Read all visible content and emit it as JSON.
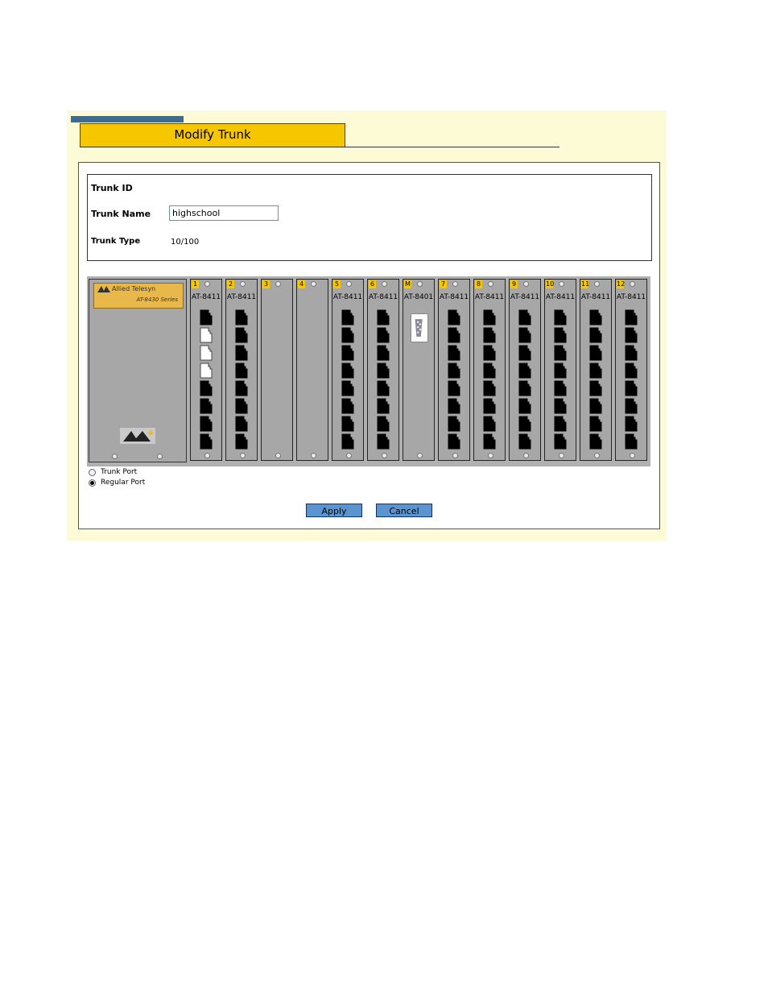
{
  "header": {
    "title": "Modify Trunk"
  },
  "form": {
    "trunk_id_label": "Trunk ID",
    "trunk_name_label": "Trunk Name",
    "trunk_name_value": "highschool",
    "trunk_type_label": "Trunk Type",
    "trunk_type_value": "10/100"
  },
  "chassis": {
    "brand": "Allied Telesyn",
    "model": "AT-8430 Series",
    "slots": [
      {
        "number": "1",
        "model": "AT-8411",
        "ports": [
          "regular",
          "trunk",
          "trunk",
          "trunk",
          "regular",
          "regular",
          "regular",
          "regular"
        ]
      },
      {
        "number": "2",
        "model": "AT-8411",
        "ports": [
          "regular",
          "regular",
          "regular",
          "regular",
          "regular",
          "regular",
          "regular",
          "regular"
        ]
      },
      {
        "number": "3",
        "model": "",
        "ports": []
      },
      {
        "number": "4",
        "model": "",
        "ports": []
      },
      {
        "number": "5",
        "model": "AT-8411",
        "ports": [
          "regular",
          "regular",
          "regular",
          "regular",
          "regular",
          "regular",
          "regular",
          "regular"
        ]
      },
      {
        "number": "6",
        "model": "AT-8411",
        "ports": [
          "regular",
          "regular",
          "regular",
          "regular",
          "regular",
          "regular",
          "regular",
          "regular"
        ]
      },
      {
        "number": "M",
        "model": "AT-8401",
        "ports": [],
        "serial": true
      },
      {
        "number": "7",
        "model": "AT-8411",
        "ports": [
          "regular",
          "regular",
          "regular",
          "regular",
          "regular",
          "regular",
          "regular",
          "regular"
        ]
      },
      {
        "number": "8",
        "model": "AT-8411",
        "ports": [
          "regular",
          "regular",
          "regular",
          "regular",
          "regular",
          "regular",
          "regular",
          "regular"
        ]
      },
      {
        "number": "9",
        "model": "AT-8411",
        "ports": [
          "regular",
          "regular",
          "regular",
          "regular",
          "regular",
          "regular",
          "regular",
          "regular"
        ]
      },
      {
        "number": "10",
        "model": "AT-8411",
        "ports": [
          "regular",
          "regular",
          "regular",
          "regular",
          "regular",
          "regular",
          "regular",
          "regular"
        ]
      },
      {
        "number": "11",
        "model": "AT-8411",
        "ports": [
          "regular",
          "regular",
          "regular",
          "regular",
          "regular",
          "regular",
          "regular",
          "regular"
        ]
      },
      {
        "number": "12",
        "model": "AT-8411",
        "ports": [
          "regular",
          "regular",
          "regular",
          "regular",
          "regular",
          "regular",
          "regular",
          "regular"
        ]
      }
    ]
  },
  "legend": {
    "trunk_port_label": "Trunk Port",
    "regular_port_label": "Regular Port",
    "selected": "regular"
  },
  "buttons": {
    "apply_label": "Apply",
    "cancel_label": "Cancel"
  },
  "colors": {
    "panel_bg": "#fdfbd6",
    "title_bg": "#f6c700",
    "button_bg": "#5b95d1",
    "slot_label_bg": "#f6c700"
  }
}
